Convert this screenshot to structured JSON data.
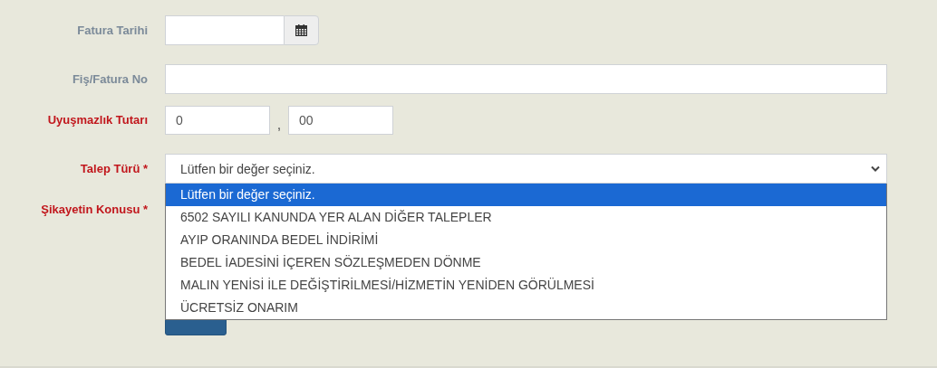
{
  "fields": [
    {
      "kind": "date",
      "label": "Fatura Tarihi",
      "required": false
    },
    {
      "kind": "text",
      "label": "Fiş/Fatura No",
      "required": false
    },
    {
      "kind": "amount",
      "label": "Uyuşmazlık Tutarı",
      "required": true,
      "value": "0",
      "separator": ",",
      "decimals": "00"
    },
    {
      "kind": "select",
      "label": "Talep Türü *",
      "required": true,
      "value": "Lütfen bir değer seçiniz.",
      "expanded": true,
      "options": [
        {
          "label": "Lütfen bir değer seçiniz.",
          "selected": true
        },
        {
          "label": "6502 SAYILI KANUNDA YER ALAN DİĞER TALEPLER",
          "selected": false
        },
        {
          "label": "AYIP ORANINDA BEDEL İNDİRİMİ",
          "selected": false
        },
        {
          "label": "BEDEL İADESİNİ İÇEREN SÖZLEŞMEDEN DÖNME",
          "selected": false
        },
        {
          "label": "MALIN YENİSİ İLE DEĞİŞTİRİLMESİ/HİZMETİN YENİDEN GÖRÜLMESİ",
          "selected": false
        },
        {
          "label": "ÜCRETSİZ ONARIM",
          "selected": false
        }
      ]
    },
    {
      "kind": "hidden",
      "label": "Şikayetin Konusu *",
      "required": true
    }
  ]
}
